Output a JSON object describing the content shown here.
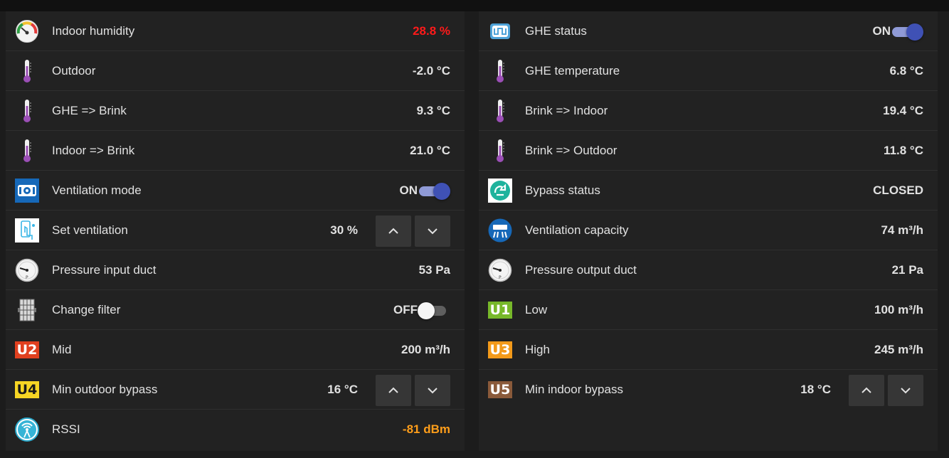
{
  "left": [
    {
      "label": "Indoor humidity",
      "value": "28.8 %",
      "icon": "humidity-gauge-icon",
      "value_color": "#ff1a1a"
    },
    {
      "label": "Outdoor",
      "value": "-2.0 °C",
      "icon": "thermometer-icon"
    },
    {
      "label": "GHE => Brink",
      "value": "9.3 °C",
      "icon": "thermometer-icon"
    },
    {
      "label": "Indoor => Brink",
      "value": "21.0 °C",
      "icon": "thermometer-icon"
    },
    {
      "label": "Ventilation mode",
      "value": "ON",
      "icon": "ventilation-unit-icon",
      "toggle": true
    },
    {
      "label": "Set ventilation",
      "value": "30 %",
      "icon": "set-ventilation-icon"
    },
    {
      "label": "Pressure input duct",
      "value": "53 Pa",
      "icon": "pressure-gauge-icon"
    },
    {
      "label": "Change filter",
      "value": "OFF",
      "icon": "filter-icon",
      "toggle": false
    },
    {
      "label": "Mid",
      "value": "200 m³/h",
      "icon": "u2-icon",
      "badge": "U2",
      "badge_bg": "#e0401f",
      "badge_fg": "#ffffff"
    },
    {
      "label": "Min outdoor bypass",
      "value": "16 °C",
      "icon": "u4-icon",
      "badge": "U4",
      "badge_bg": "#f6d524",
      "badge_fg": "#1a1a1a"
    },
    {
      "label": "RSSI",
      "value": "-81 dBm",
      "icon": "wifi-signal-icon",
      "value_color": "#ff9e1a"
    }
  ],
  "right": [
    {
      "label": "GHE status",
      "value": "ON",
      "icon": "ghe-icon",
      "toggle": true
    },
    {
      "label": "GHE temperature",
      "value": "6.8 °C",
      "icon": "thermometer-icon"
    },
    {
      "label": "Brink => Indoor",
      "value": "19.4 °C",
      "icon": "thermometer-icon"
    },
    {
      "label": "Brink => Outdoor",
      "value": "11.8 °C",
      "icon": "thermometer-icon"
    },
    {
      "label": "Bypass status",
      "value": "CLOSED",
      "icon": "bypass-icon"
    },
    {
      "label": "Ventilation capacity",
      "value": "74 m³/h",
      "icon": "fan-capacity-icon"
    },
    {
      "label": "Pressure output duct",
      "value": "21 Pa",
      "icon": "pressure-gauge-icon"
    },
    {
      "label": "Low",
      "value": "100 m³/h",
      "icon": "u1-icon",
      "badge": "U1",
      "badge_bg": "#77b82a",
      "badge_fg": "#ffffff"
    },
    {
      "label": "High",
      "value": "245 m³/h",
      "icon": "u3-icon",
      "badge": "U3",
      "badge_bg": "#f39a1a",
      "badge_fg": "#ffffff"
    },
    {
      "label": "Min indoor bypass",
      "value": "18 °C",
      "icon": "u5-icon",
      "badge": "U5",
      "badge_bg": "#8a5a3a",
      "badge_fg": "#ffffff"
    }
  ],
  "colors": {
    "accent": "#3f51b5",
    "value_red": "#ff1a1a",
    "value_orange": "#ff9e1a"
  }
}
